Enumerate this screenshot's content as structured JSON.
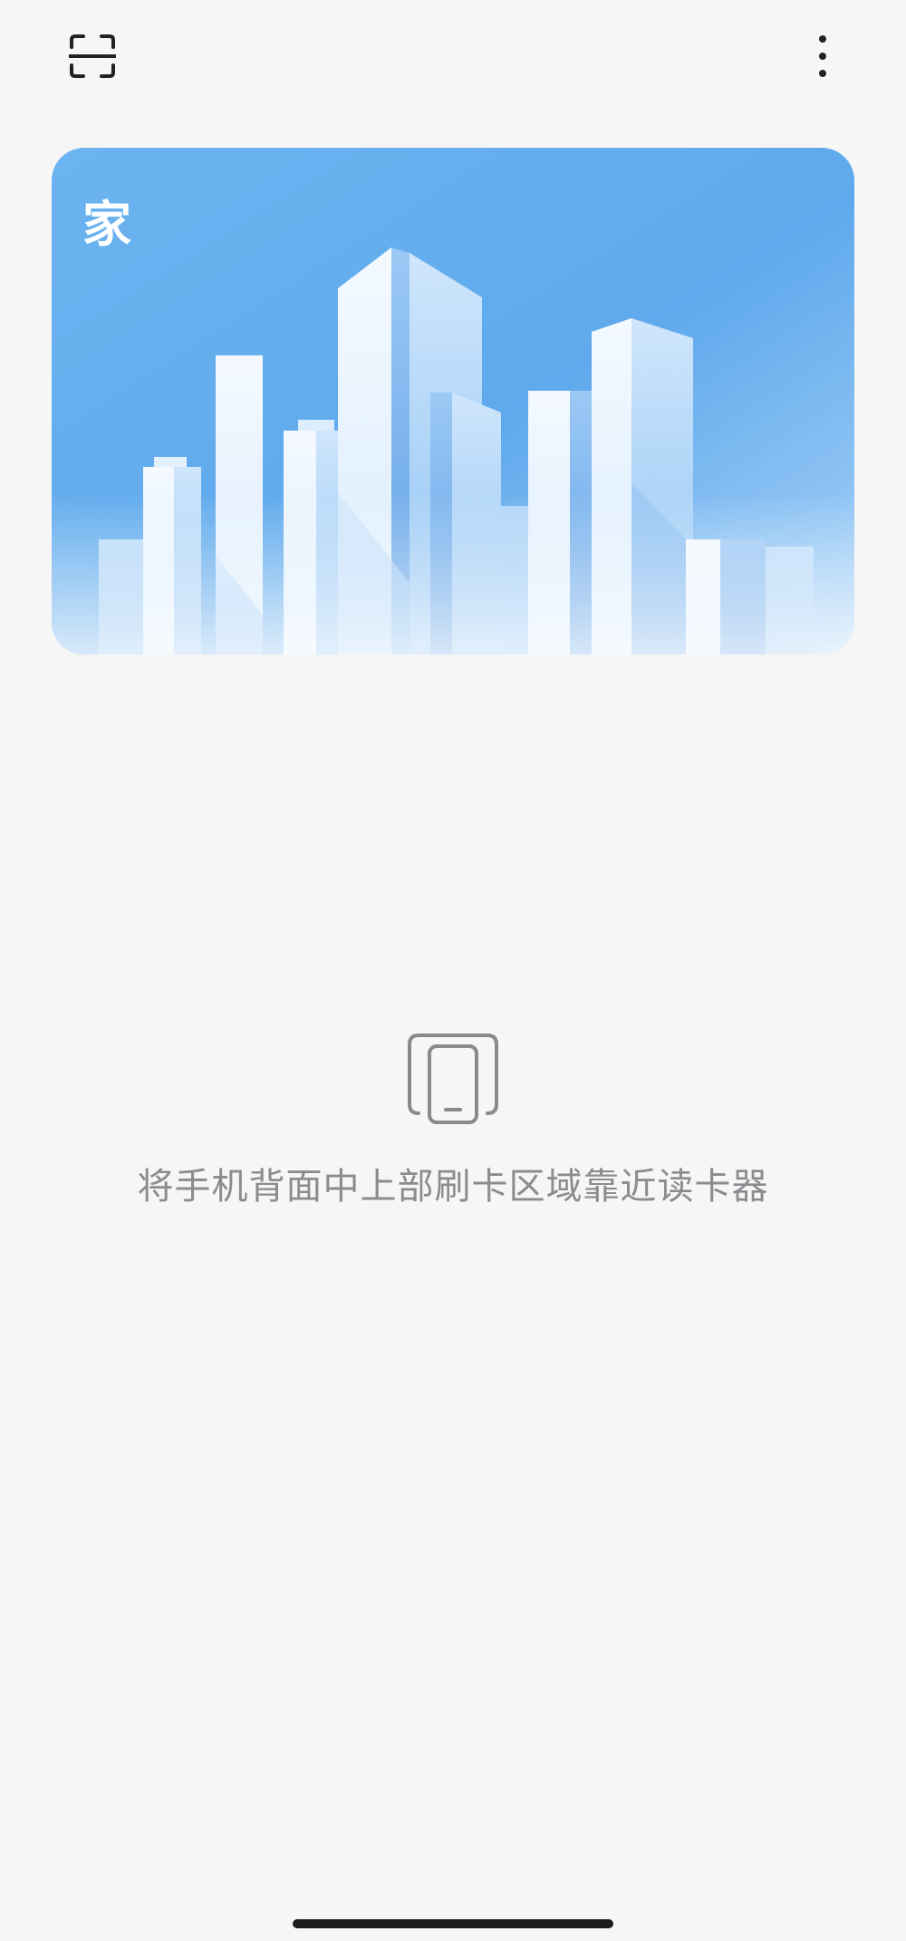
{
  "header": {
    "scan_icon": "scan-icon",
    "more_icon": "more-vertical-icon"
  },
  "card": {
    "name": "家",
    "artwork": "city-skyline-illustration",
    "colors": {
      "sky_top": "#5aa8ec",
      "sky_bottom": "#a9d2f8",
      "building_light": "#eef6fe",
      "building_mid": "#b9dbfa",
      "building_shadow": "#7fb6ef"
    }
  },
  "reader_prompt": {
    "icon": "phone-nfc-icon",
    "text": "将手机背面中上部刷卡区域靠近读卡器"
  },
  "system": {
    "home_indicator": "home-indicator"
  }
}
